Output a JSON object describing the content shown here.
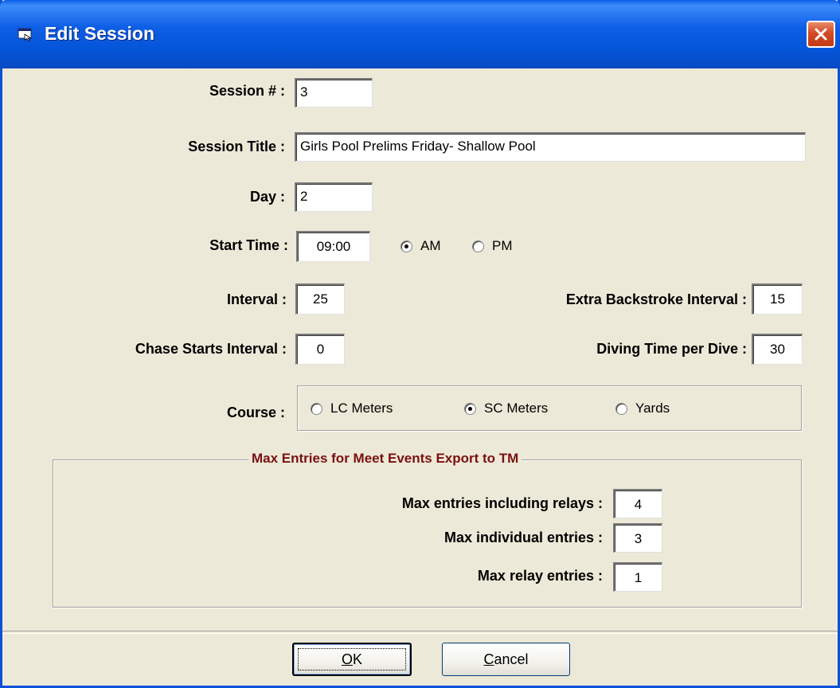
{
  "window": {
    "title": "Edit Session",
    "close_icon": "close-x-icon"
  },
  "form": {
    "session_number": {
      "label": "Session # :",
      "value": "3"
    },
    "session_title": {
      "label": "Session Title :",
      "value": "Girls Pool Prelims Friday- Shallow Pool"
    },
    "day": {
      "label": "Day :",
      "value": "2"
    },
    "start_time": {
      "label": "Start Time :",
      "value": "09:00",
      "am_label": "AM",
      "pm_label": "PM",
      "selected": "AM"
    },
    "interval": {
      "label": "Interval :",
      "value": "25"
    },
    "extra_backstroke_interval": {
      "label": "Extra Backstroke Interval :",
      "value": "15"
    },
    "chase_starts_interval": {
      "label": "Chase Starts Interval :",
      "value": "0"
    },
    "diving_time_per_dive": {
      "label": "Diving Time per Dive :",
      "value": "30"
    },
    "course": {
      "label": "Course :",
      "options": [
        "LC Meters",
        "SC Meters",
        "Yards"
      ],
      "selected": "SC Meters"
    }
  },
  "max_entries": {
    "title": "Max Entries for Meet Events Export to TM",
    "including_relays": {
      "label": "Max entries including relays :",
      "value": "4"
    },
    "individual": {
      "label": "Max individual entries :",
      "value": "3"
    },
    "relay": {
      "label": "Max relay entries :",
      "value": "1"
    }
  },
  "buttons": {
    "ok_prefix": "",
    "ok_accel": "O",
    "ok_rest": "K",
    "cancel_accel": "C",
    "cancel_rest": "ancel"
  },
  "colors": {
    "titlebar": "#0454d8",
    "window_bg": "#ece9d8",
    "group_title": "#7a1010",
    "close_button": "#d44a24"
  }
}
